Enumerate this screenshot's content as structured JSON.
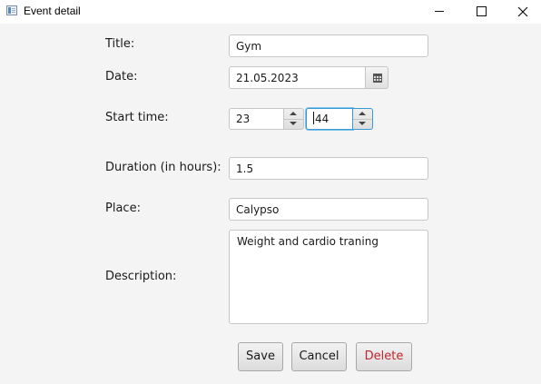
{
  "window": {
    "title": "Event detail",
    "icons": [
      "app-icon",
      "minimize-icon",
      "maximize-icon",
      "close-icon"
    ]
  },
  "form": {
    "title": {
      "label": "Title:",
      "value": "Gym"
    },
    "date": {
      "label": "Date:",
      "value": "21.05.2023",
      "picker_icon": "calendar-icon"
    },
    "start_time": {
      "label": "Start time:",
      "hour": "23",
      "minute": "44"
    },
    "duration": {
      "label": "Duration (in hours):",
      "value": "1.5"
    },
    "place": {
      "label": "Place:",
      "value": "Calypso"
    },
    "description": {
      "label": "Description:",
      "value": "Weight and cardio traning"
    }
  },
  "buttons": {
    "save": "Save",
    "cancel": "Cancel",
    "delete": "Delete"
  },
  "colors": {
    "focus": "#3a9bd4",
    "delete_text": "#c0262b",
    "background": "#f4f4f4"
  }
}
